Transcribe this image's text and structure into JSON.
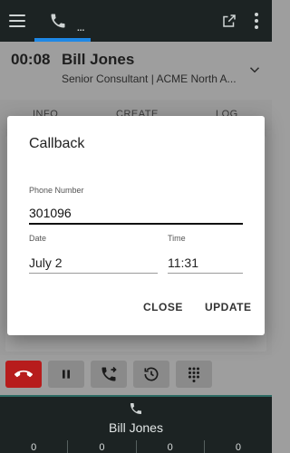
{
  "icons": {
    "menu": "hamburger-menu-icon",
    "phone": "phone-icon",
    "popout": "open-in-new-icon",
    "more": "more-vert-icon",
    "expand": "chevron-down-icon",
    "hangup": "call-end-icon",
    "hold": "pause-icon",
    "transfer": "phone-forward-icon",
    "history": "history-icon",
    "dialpad": "dialpad-icon"
  },
  "header": {
    "tab_dots": "..."
  },
  "contact": {
    "duration": "00:08",
    "name": "Bill Jones",
    "subtitle": "Senior Consultant | ACME North A..."
  },
  "tabs": [
    {
      "label": "INFO"
    },
    {
      "label": "CREATE"
    },
    {
      "label": "LOG"
    }
  ],
  "dialog": {
    "title": "Callback",
    "phone_label": "Phone Number",
    "phone_value": "301096",
    "date_label": "Date",
    "date_value": "July 2",
    "time_label": "Time",
    "time_value": "11:31",
    "close_label": "CLOSE",
    "update_label": "UPDATE"
  },
  "callstrip": {
    "name": "Bill Jones",
    "counters": [
      "0",
      "0",
      "0",
      "0"
    ]
  },
  "colors": {
    "header_bg": "#1c2323",
    "tab_indicator": "#1e88e5",
    "hangup": "#b71c1c",
    "strip_border": "#2e6b64"
  }
}
